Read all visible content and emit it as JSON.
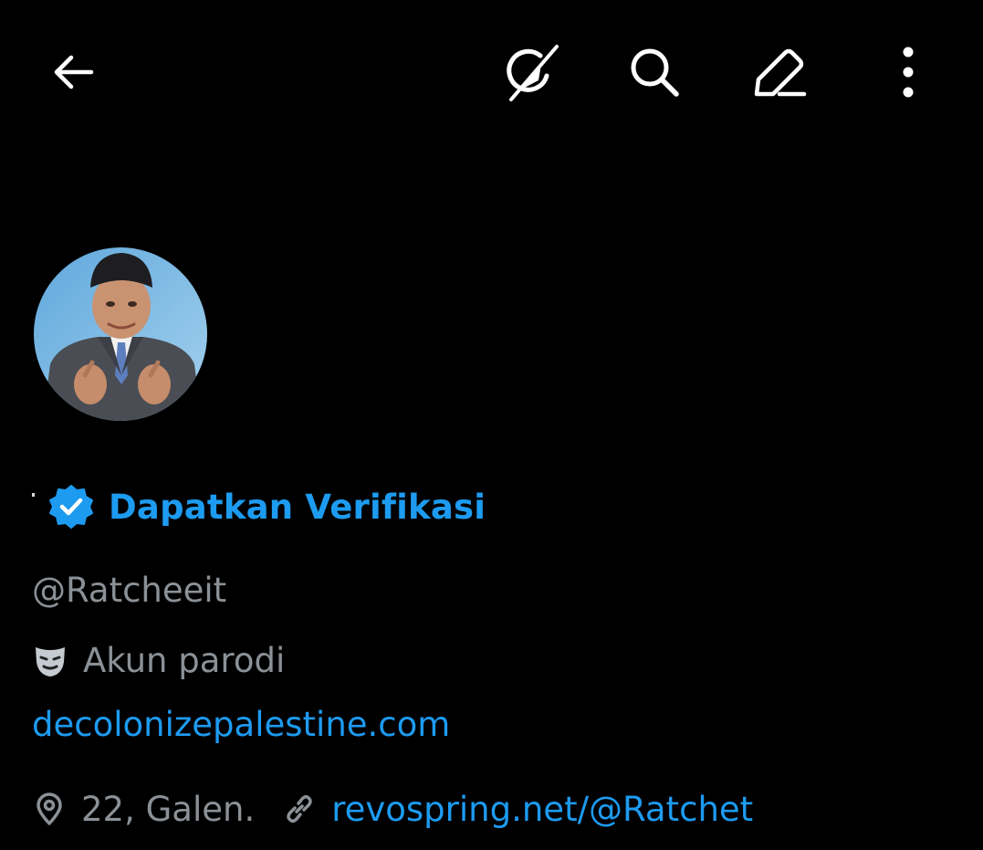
{
  "header": {
    "icons": {
      "back": "arrow-left-icon",
      "grok": "grok-icon",
      "search": "search-icon",
      "compose": "pencil-icon",
      "more": "more-vertical-icon"
    }
  },
  "profile": {
    "avatar_icon": "avatar",
    "verify_cta": "Dapatkan Verifikasi",
    "handle": "@Ratcheeit",
    "parody_label": "Akun parodi",
    "bio_link": "decolonizepalestine.com",
    "location": "22, Galen.",
    "website": "revospring.net/@Ratchet"
  },
  "colors": {
    "background": "#000000",
    "accent": "#1d9bf0",
    "secondary_text": "#8b9196",
    "icon": "#ffffff"
  }
}
